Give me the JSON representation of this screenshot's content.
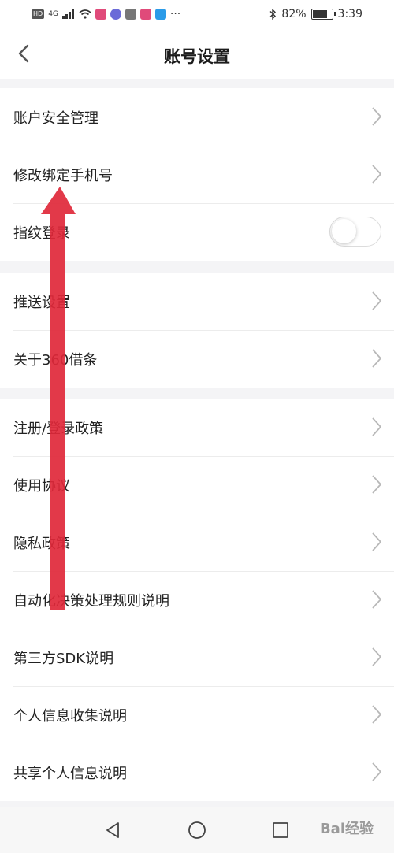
{
  "status_bar": {
    "network_badge": "HD",
    "signal_label": "4G",
    "more": "···",
    "battery_percent": "82%",
    "battery_level": 0.82,
    "time": "3:39"
  },
  "header": {
    "title": "账号设置"
  },
  "groups": [
    {
      "items": [
        {
          "label": "账户安全管理",
          "control": "chevron"
        },
        {
          "label": "修改绑定手机号",
          "control": "chevron"
        },
        {
          "label": "指纹登录",
          "control": "toggle",
          "toggle_on": false
        }
      ]
    },
    {
      "items": [
        {
          "label": "推送设置",
          "control": "chevron"
        },
        {
          "label": "关于360借条",
          "control": "chevron"
        }
      ]
    },
    {
      "items": [
        {
          "label": "注册/登录政策",
          "control": "chevron"
        },
        {
          "label": "使用协议",
          "control": "chevron"
        },
        {
          "label": "隐私政策",
          "control": "chevron"
        },
        {
          "label": "自动化决策处理规则说明",
          "control": "chevron"
        },
        {
          "label": "第三方SDK说明",
          "control": "chevron"
        },
        {
          "label": "个人信息收集说明",
          "control": "chevron"
        },
        {
          "label": "共享个人信息说明",
          "control": "chevron"
        }
      ]
    }
  ],
  "watermark": "Bai经验",
  "colors": {
    "annotation_arrow": "#e0283a",
    "divider": "#ececec",
    "background": "#f4f4f6"
  }
}
